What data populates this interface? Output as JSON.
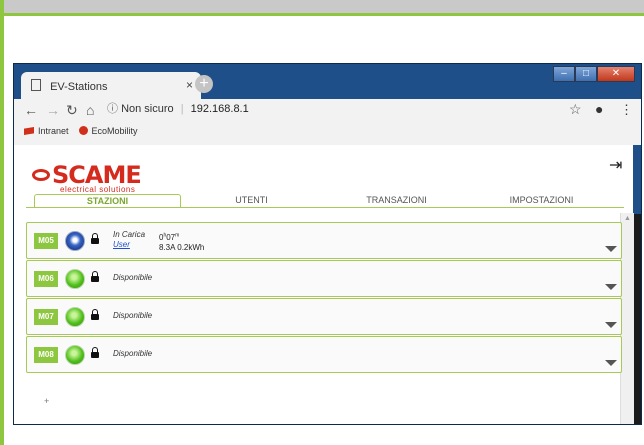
{
  "browser": {
    "tab_title": "EV-Stations",
    "tab_close": "×",
    "new_tab": "+",
    "security_label": "Non sicuro",
    "address": "192.168.8.1",
    "bookmarks": [
      {
        "label": "Intranet",
        "icon": "flag-icon"
      },
      {
        "label": "EcoMobility",
        "icon": "leaf-icon"
      }
    ]
  },
  "app": {
    "brand": "SCAME",
    "tagline": "electrical solutions",
    "tabs": [
      {
        "label": "STAZIONI",
        "active": true
      },
      {
        "label": "UTENTI",
        "active": false
      },
      {
        "label": "TRANSAZIONI",
        "active": false
      },
      {
        "label": "IMPOSTAZIONI",
        "active": false
      }
    ],
    "stations": [
      {
        "id": "M05",
        "led": "charging",
        "status": "In Carica",
        "user": "User",
        "duration_h": "0",
        "duration_m": "07",
        "reading": "8.3A 0.2kWh"
      },
      {
        "id": "M06",
        "led": "available",
        "status": "Disponibile"
      },
      {
        "id": "M07",
        "led": "available",
        "status": "Disponibile"
      },
      {
        "id": "M08",
        "led": "available",
        "status": "Disponibile"
      }
    ],
    "add_label": "+"
  },
  "colors": {
    "accent_green": "#8dc63f",
    "brand_red": "#d52b1e",
    "charging_blue": "#3a67c8",
    "available_green": "#52c01d"
  }
}
